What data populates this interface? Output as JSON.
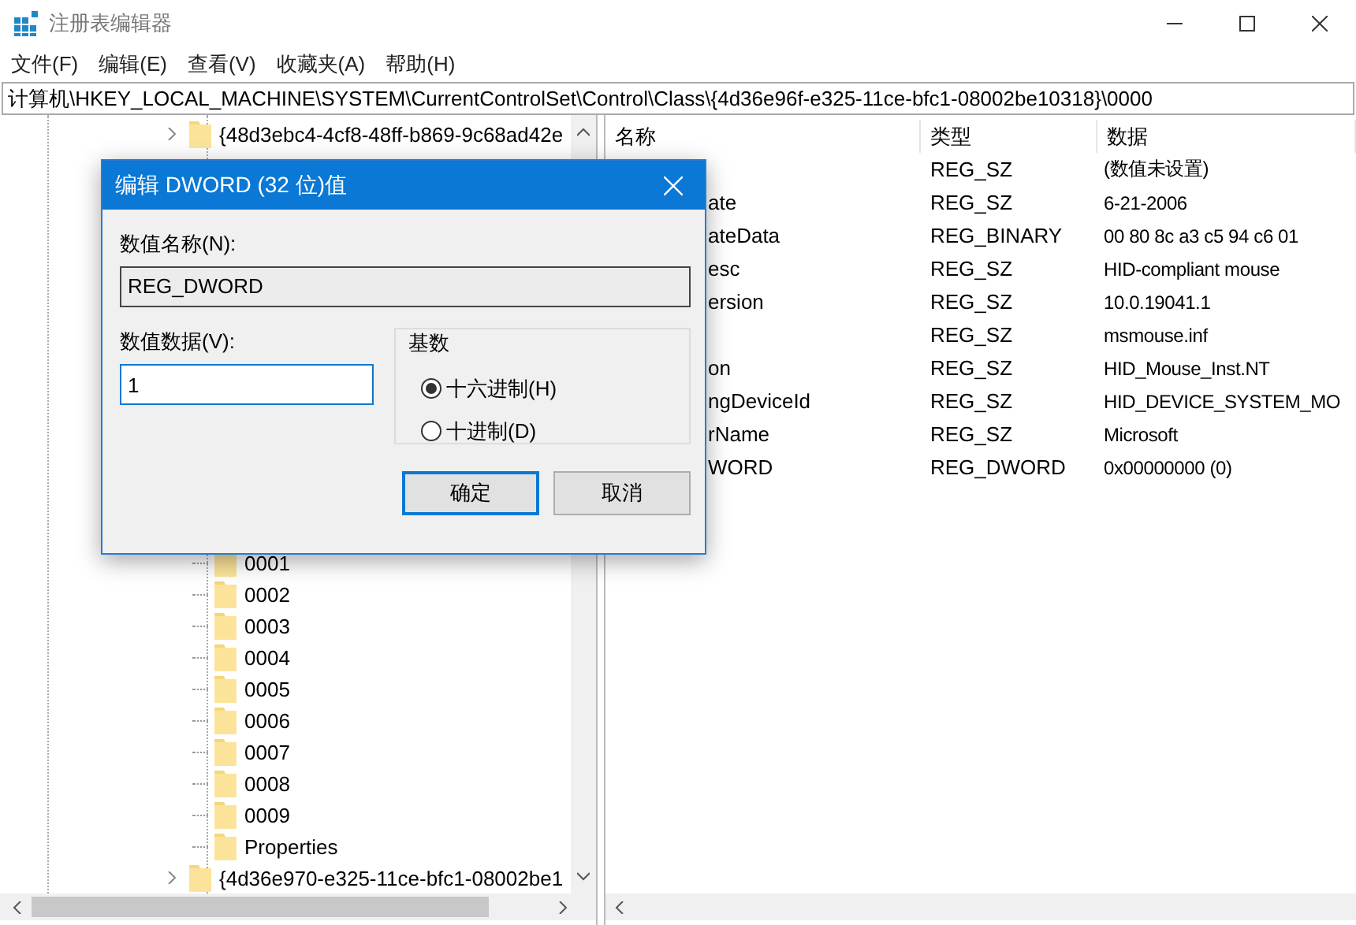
{
  "window": {
    "title": "注册表编辑器"
  },
  "menu": [
    {
      "label": "文件(F)"
    },
    {
      "label": "编辑(E)"
    },
    {
      "label": "查看(V)"
    },
    {
      "label": "收藏夹(A)"
    },
    {
      "label": "帮助(H)"
    }
  ],
  "address": "计算机\\HKEY_LOCAL_MACHINE\\SYSTEM\\CurrentControlSet\\Control\\Class\\{4d36e96f-e325-11ce-bfc1-08002be10318}\\0000",
  "tree": {
    "above": [
      {
        "label": "{48d3ebc4-4cf8-48ff-b869-9c68ad42e",
        "expanded": false
      }
    ],
    "children": [
      {
        "label": "0001"
      },
      {
        "label": "0002"
      },
      {
        "label": "0003"
      },
      {
        "label": "0004"
      },
      {
        "label": "0005"
      },
      {
        "label": "0006"
      },
      {
        "label": "0007"
      },
      {
        "label": "0008"
      },
      {
        "label": "0009"
      },
      {
        "label": "Properties"
      }
    ],
    "below": [
      {
        "label": "{4d36e970-e325-11ce-bfc1-08002be1",
        "expanded": false
      }
    ]
  },
  "list": {
    "columns": [
      "名称",
      "类型",
      "数据"
    ],
    "rows": [
      {
        "type": "REG_SZ",
        "data": "(数值未设置)"
      },
      {
        "name": "ate",
        "type": "REG_SZ",
        "data": "6-21-2006"
      },
      {
        "name": "ateData",
        "type": "REG_BINARY",
        "data": "00 80 8c a3 c5 94 c6 01"
      },
      {
        "name": "esc",
        "type": "REG_SZ",
        "data": "HID-compliant mouse"
      },
      {
        "name": "ersion",
        "type": "REG_SZ",
        "data": "10.0.19041.1"
      },
      {
        "type": "REG_SZ",
        "data": "msmouse.inf"
      },
      {
        "name": "on",
        "type": "REG_SZ",
        "data": "HID_Mouse_Inst.NT"
      },
      {
        "name": "ngDeviceId",
        "type": "REG_SZ",
        "data": "HID_DEVICE_SYSTEM_MO"
      },
      {
        "name": "rName",
        "type": "REG_SZ",
        "data": "Microsoft"
      },
      {
        "name": "WORD",
        "type": "REG_DWORD",
        "data": "0x00000000 (0)"
      }
    ]
  },
  "dialog": {
    "title": "编辑 DWORD (32 位)值",
    "name_label": "数值名称(N):",
    "name_value": "REG_DWORD",
    "data_label": "数值数据(V):",
    "data_value": "1",
    "base_label": "基数",
    "radios": [
      {
        "label": "十六进制(H)",
        "selected": true
      },
      {
        "label": "十进制(D)",
        "selected": false
      }
    ],
    "buttons": [
      {
        "label": "确定",
        "default": true
      },
      {
        "label": "取消",
        "default": false
      }
    ]
  }
}
